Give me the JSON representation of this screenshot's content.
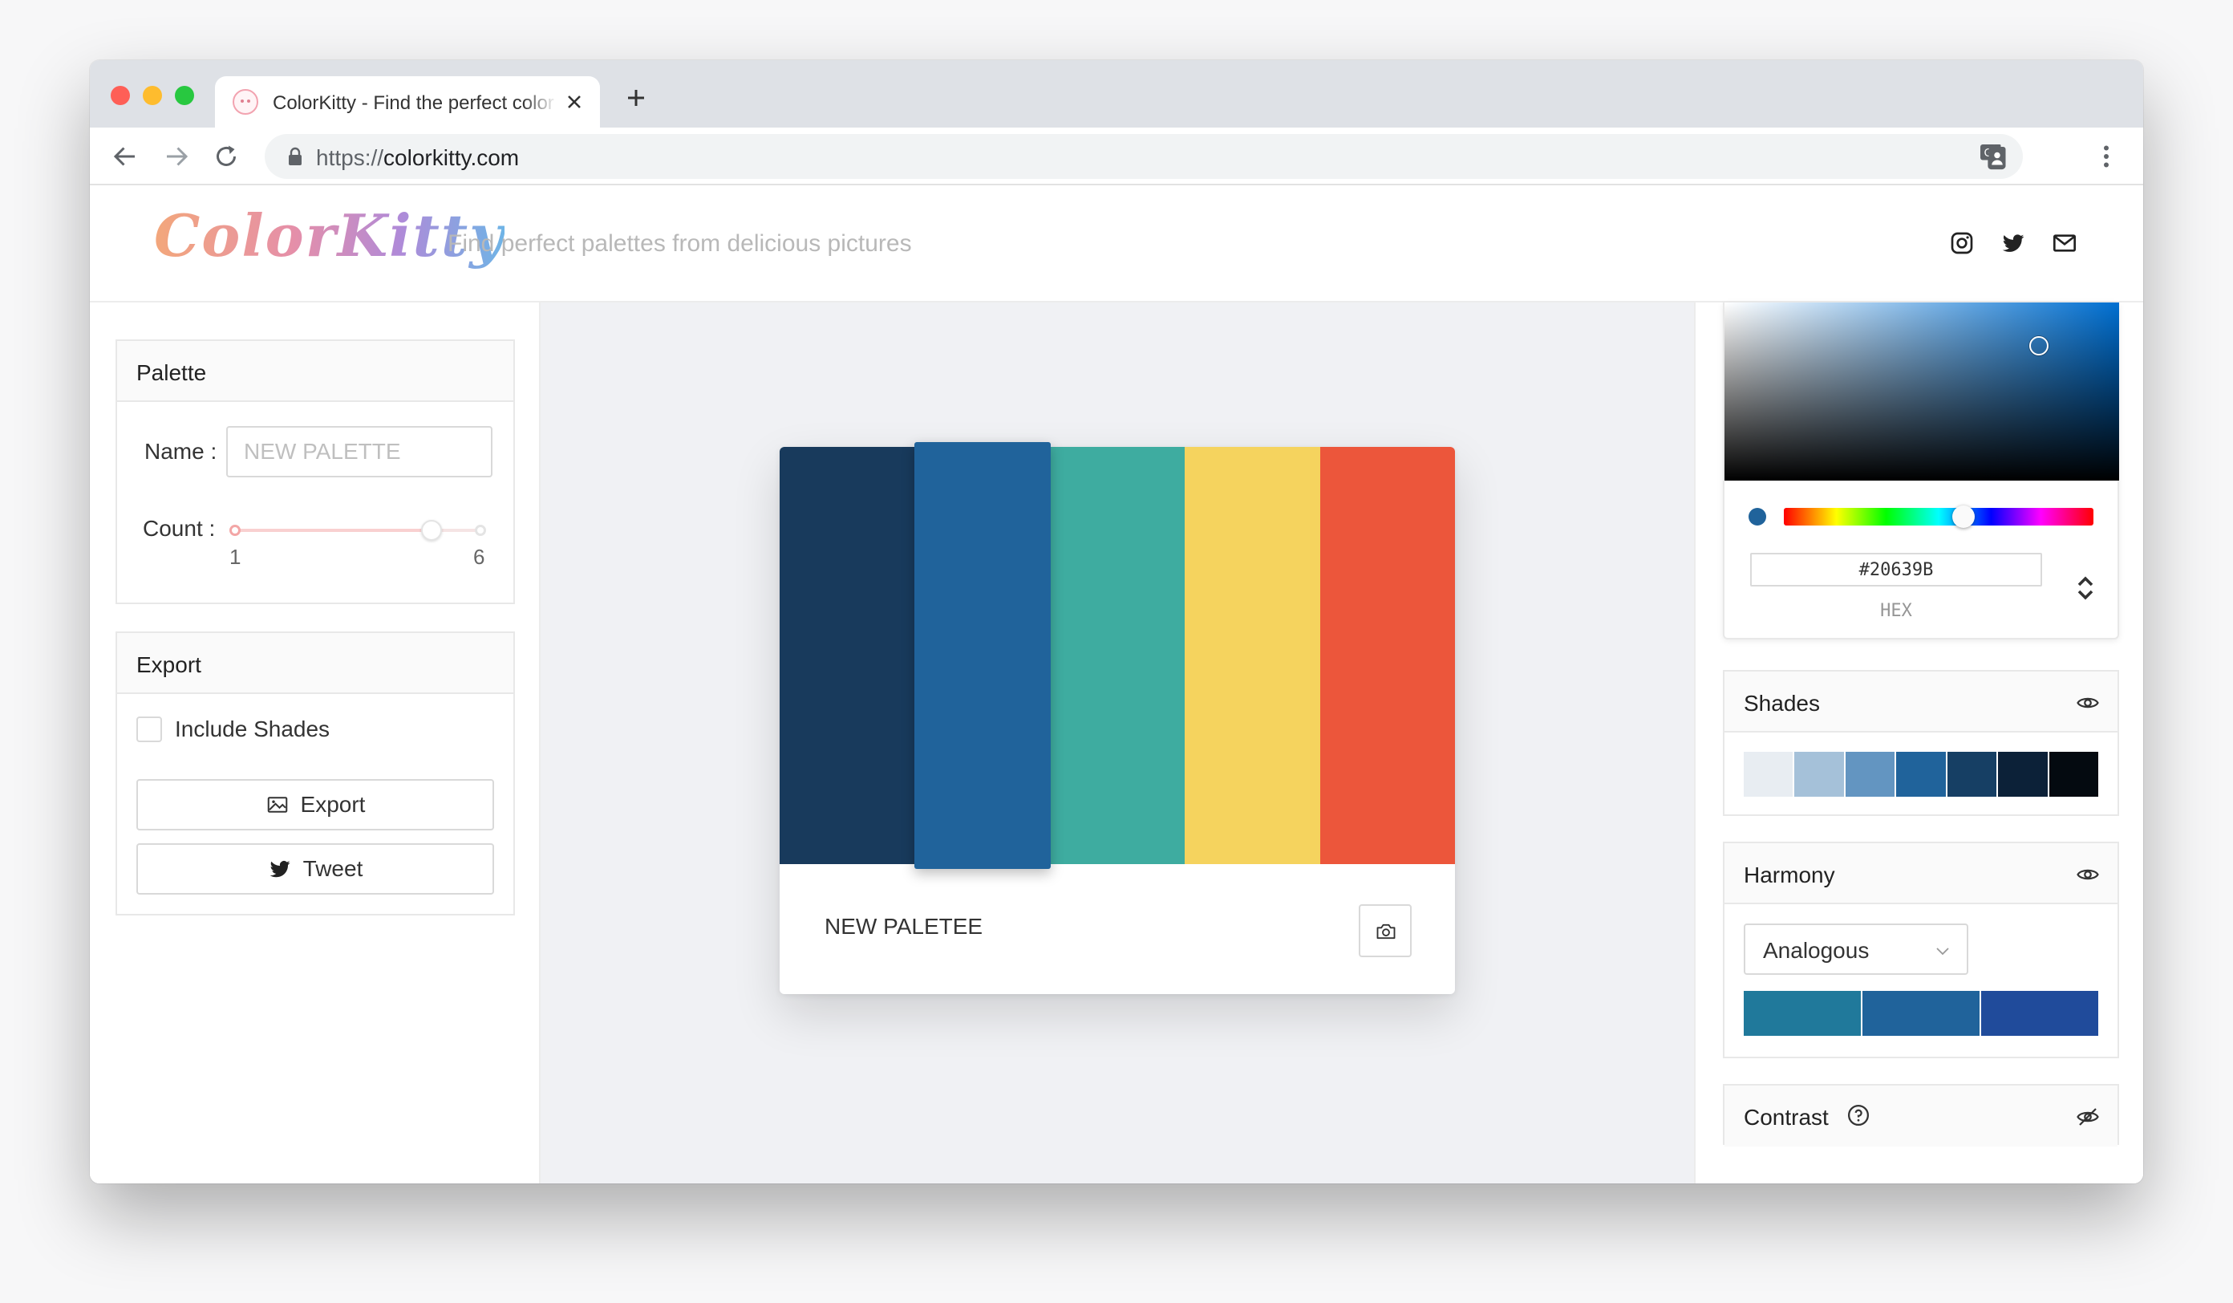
{
  "browser": {
    "tab_title": "ColorKitty - Find the perfect color palettes",
    "url_scheme": "https://",
    "url_host": "colorkitty.com"
  },
  "header": {
    "logo": "ColorKitty",
    "tagline": "Find perfect palettes from delicious pictures"
  },
  "palette_panel": {
    "title": "Palette",
    "name_label": "Name",
    "name_placeholder": "NEW PALETTE",
    "count_label": "Count",
    "count_min": "1",
    "count_max": "6",
    "count_value": 5
  },
  "export_panel": {
    "title": "Export",
    "include_shades_label": "Include Shades",
    "include_shades_checked": false,
    "export_label": "Export",
    "tweet_label": "Tweet"
  },
  "palette": {
    "name": "NEW PALETEE",
    "colors": [
      "#183a5c",
      "#20639b",
      "#3eaca0",
      "#f5d35e",
      "#ec563b"
    ],
    "selected_index": 1
  },
  "picker": {
    "hex_value": "#20639B",
    "hex_label": "HEX",
    "hue_fraction": 0.58
  },
  "shades": {
    "title": "Shades",
    "colors": [
      "#e8edf2",
      "#a5c1d9",
      "#6395c1",
      "#20639b",
      "#163f64",
      "#0c2138",
      "#040a10"
    ]
  },
  "harmony": {
    "title": "Harmony",
    "mode": "Analogous",
    "colors": [
      "#20799b",
      "#20639b",
      "#204b9b"
    ]
  },
  "contrast": {
    "title": "Contrast"
  }
}
